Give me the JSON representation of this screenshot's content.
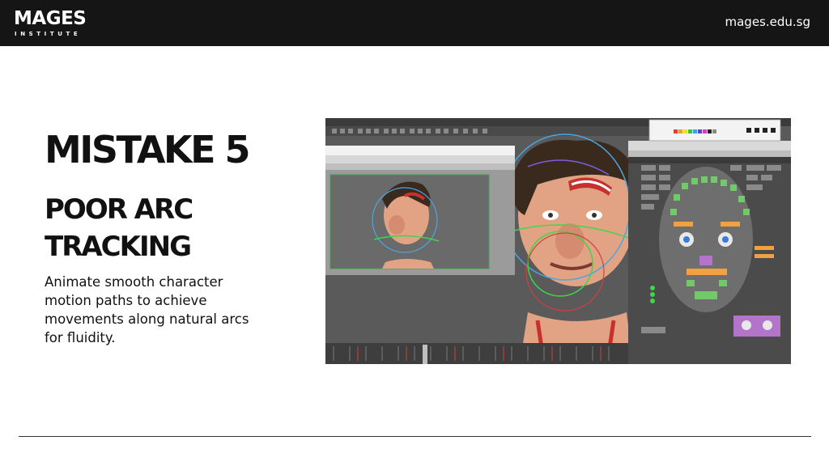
{
  "header": {
    "logo_main": "MAGES",
    "logo_sub": "INSTITUTE",
    "site_url": "mages.edu.sg"
  },
  "slide": {
    "title": "MISTAKE 5",
    "subtitle_line1": "POOR ARC",
    "subtitle_line2": "TRACKING",
    "description": "Animate smooth character motion paths to achieve movements along natural arcs for fluidity."
  },
  "screenshot": {
    "picker_buttons": [
      "All",
      "Bes",
      "Head",
      "Bes",
      "Neck",
      "Bes",
      "Body",
      "Hand",
      "Arm",
      "Brow",
      "Allbes",
      "Inside",
      "Face"
    ],
    "colors": {
      "bg": "#5a5a5a",
      "skin": "#e2a385",
      "hair": "#3a2a1e",
      "arc_green": "#3fd64a",
      "arc_blue": "#4aa6e0",
      "picker_orange": "#f3a043",
      "picker_green": "#72c96a",
      "picker_purple": "#b275c9"
    }
  }
}
